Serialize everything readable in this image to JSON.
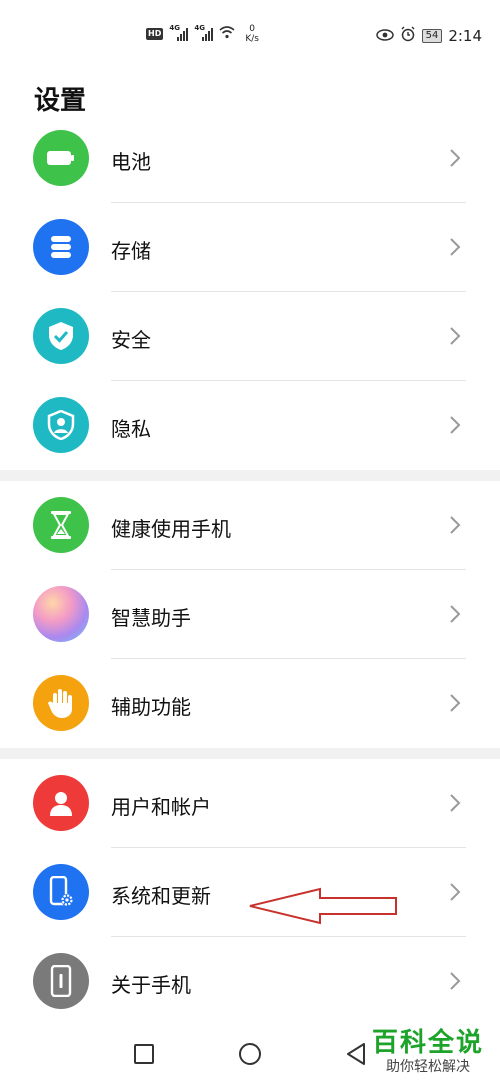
{
  "status_bar": {
    "hd": "HD",
    "net1": "4G",
    "net2": "4G",
    "speed_value": "0",
    "speed_unit": "K/s",
    "battery": "54",
    "time": "2:14"
  },
  "title": "设置",
  "groups": [
    [
      {
        "label": "电池",
        "icon": "battery-icon",
        "color": "#3ec24a"
      },
      {
        "label": "存储",
        "icon": "storage-icon",
        "color": "#1f73f0"
      },
      {
        "label": "安全",
        "icon": "shield-check-icon",
        "color": "#1fb9c4"
      },
      {
        "label": "隐私",
        "icon": "privacy-shield-icon",
        "color": "#1fb9c4"
      }
    ],
    [
      {
        "label": "健康使用手机",
        "icon": "hourglass-icon",
        "color": "#3ec24a"
      },
      {
        "label": "智慧助手",
        "icon": "smart-assistant-icon",
        "color": "#c9a8f0"
      },
      {
        "label": "辅助功能",
        "icon": "hand-icon",
        "color": "#f5a20f"
      }
    ],
    [
      {
        "label": "用户和帐户",
        "icon": "user-icon",
        "color": "#ef3a3a"
      },
      {
        "label": "系统和更新",
        "icon": "phone-gear-icon",
        "color": "#1f73f0"
      },
      {
        "label": "关于手机",
        "icon": "phone-info-icon",
        "color": "#7a7a7a"
      }
    ]
  ],
  "watermark": {
    "main": "百科全说",
    "sub": "助你轻松解决"
  }
}
